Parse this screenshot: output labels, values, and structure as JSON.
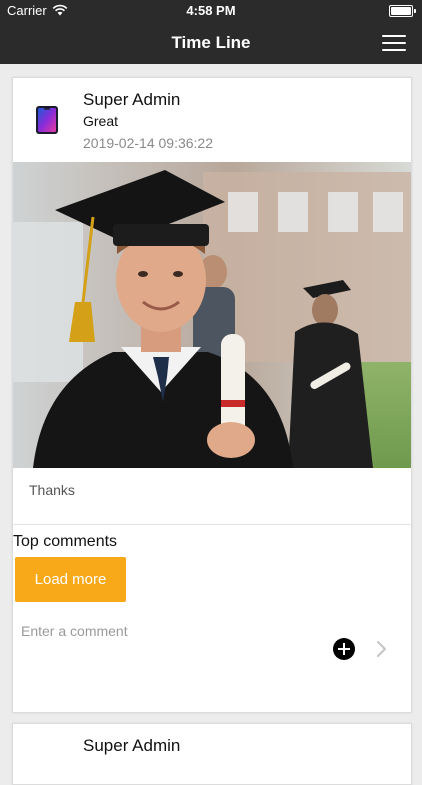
{
  "status_bar": {
    "carrier": "Carrier",
    "time": "4:58 PM"
  },
  "nav": {
    "title": "Time Line",
    "menu_icon": "hamburger-menu-icon"
  },
  "posts": [
    {
      "author": "Super Admin",
      "subtitle": "Great",
      "timestamp": "2019-02-14 09:36:22",
      "image_description": "graduate-photo",
      "caption": "Thanks",
      "comments_title": "Top comments",
      "load_more_label": "Load more",
      "comment_placeholder": "Enter a comment"
    },
    {
      "author": "Super Admin"
    }
  ],
  "colors": {
    "nav_bg": "#2b2b2b",
    "accent": "#f7a91a",
    "page_bg": "#ececec"
  }
}
